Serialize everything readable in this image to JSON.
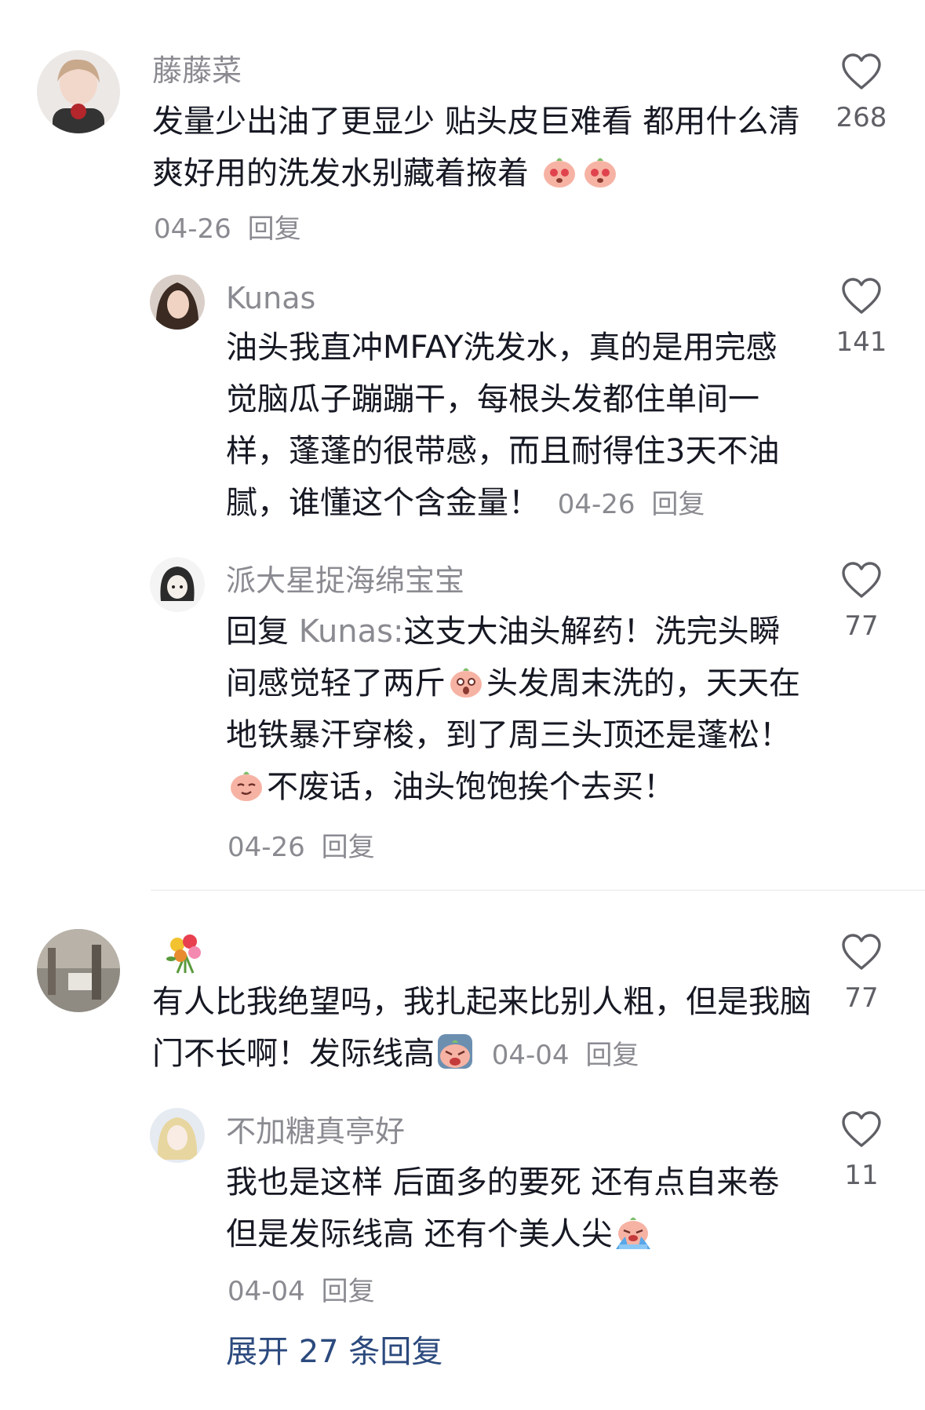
{
  "comments": [
    {
      "username": "藤藤菜",
      "text": "发量少出油了更显少 贴头皮巨难看 都用什么清爽好用的洗发水别藏着掖着",
      "date": "04-26",
      "reply": "回复",
      "likes": "268",
      "emoji_after": [
        "blush-emoji",
        "blush-emoji"
      ]
    },
    {
      "username": "Kunas",
      "text": "油头我直冲MFAY洗发水，真的是用完感觉脑瓜子蹦蹦干，每根头发都住单间一样，蓬蓬的很带感，而且耐得住3天不油腻，谁懂这个含金量！",
      "date": "04-26",
      "reply": "回复",
      "likes": "141"
    },
    {
      "username": "派大星捉海绵宝宝",
      "reply_prefix": "回复",
      "reply_to": "Kunas:",
      "text_1": "这支大油头解药！洗完头瞬间感觉轻了两斤",
      "text_2": "头发周末洗的，天天在地铁暴汗穿梭，到了周三头顶还是蓬松！",
      "text_3": "不废话，油头饱饱挨个去买！",
      "date": "04-26",
      "reply": "回复",
      "likes": "77"
    },
    {
      "username": "",
      "badge_icon": "flower-bouquet-emoji",
      "text": "有人比我绝望吗，我扎起来比别人粗，但是我脑门不长啊！发际线高",
      "date": "04-04",
      "reply": "回复",
      "likes": "77"
    },
    {
      "username": "不加糖真亭好",
      "text": "我也是这样 后面多的要死 还有点自来卷  但是发际线高 还有个美人尖",
      "date": "04-04",
      "reply": "回复",
      "likes": "11"
    }
  ],
  "expand_label": "展开 27 条回复",
  "colors": {
    "text": "#161823",
    "muted": "#8a8b91",
    "link": "#2c4a7e",
    "emoji": "#f6b3a4"
  }
}
